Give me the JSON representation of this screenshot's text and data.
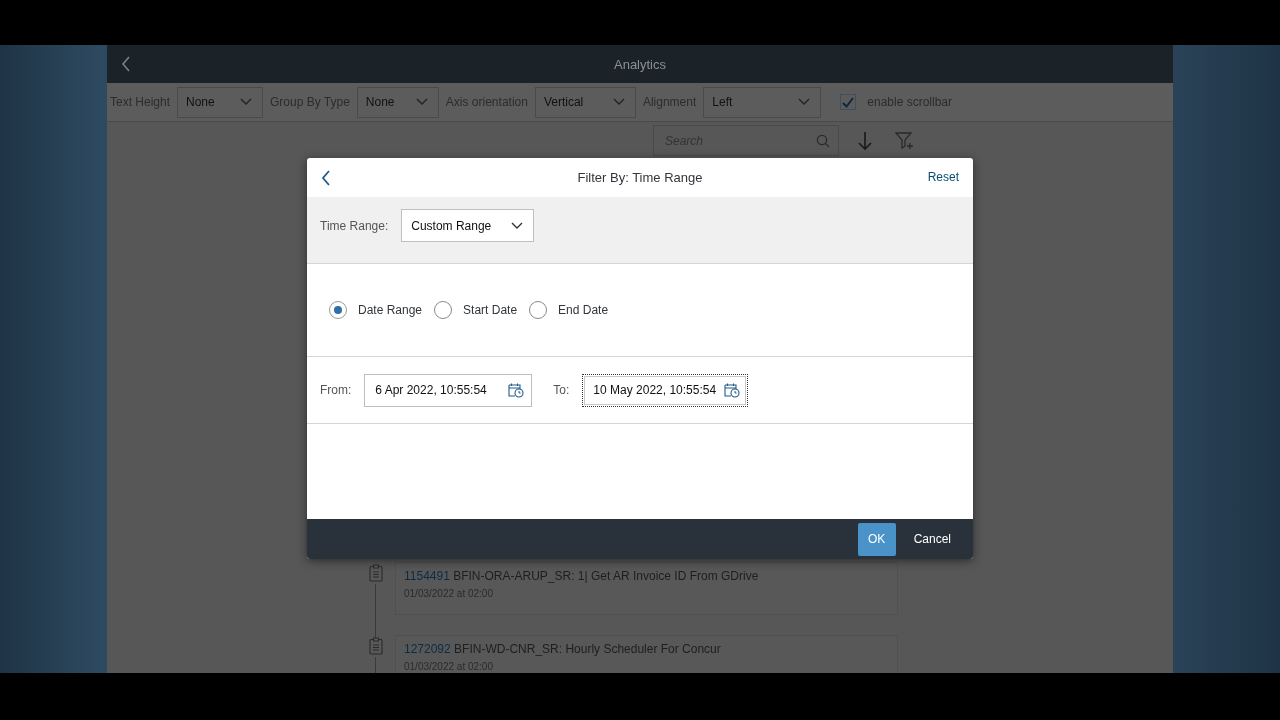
{
  "app": {
    "title": "Analytics"
  },
  "toolbar": {
    "selects": [
      {
        "label": "Text Height",
        "value": "None"
      },
      {
        "label": "Group By Type",
        "value": "None"
      },
      {
        "label": "Axis orientation",
        "value": "Vertical"
      },
      {
        "label": "Alignment",
        "value": "Left"
      }
    ],
    "checkbox": {
      "label": "enable scrollbar",
      "checked": true
    }
  },
  "search": {
    "placeholder": "Search"
  },
  "timeline": [
    {
      "id": "1154491",
      "title": "BFIN-ORA-ARUP_SR: 1| Get AR Invoice ID From GDrive",
      "time": "01/03/2022 at 02:00"
    },
    {
      "id": "1272092",
      "title": "BFIN-WD-CNR_SR: Hourly Scheduler For Concur",
      "time": "01/03/2022 at 02:00"
    }
  ],
  "dialog": {
    "title": "Filter By: Time Range",
    "reset": "Reset",
    "time_range": {
      "label": "Time Range:",
      "value": "Custom Range"
    },
    "options": [
      {
        "label": "Date Range",
        "selected": true
      },
      {
        "label": "Start Date",
        "selected": false
      },
      {
        "label": "End Date",
        "selected": false
      }
    ],
    "from": {
      "label": "From:",
      "value": "6 Apr 2022, 10:55:54",
      "focused": false
    },
    "to": {
      "label": "To:",
      "value": "10 May 2022, 10:55:54",
      "focused": true
    },
    "buttons": [
      {
        "label": "OK",
        "kind": "primary"
      },
      {
        "label": "Cancel",
        "kind": "plain"
      }
    ]
  }
}
